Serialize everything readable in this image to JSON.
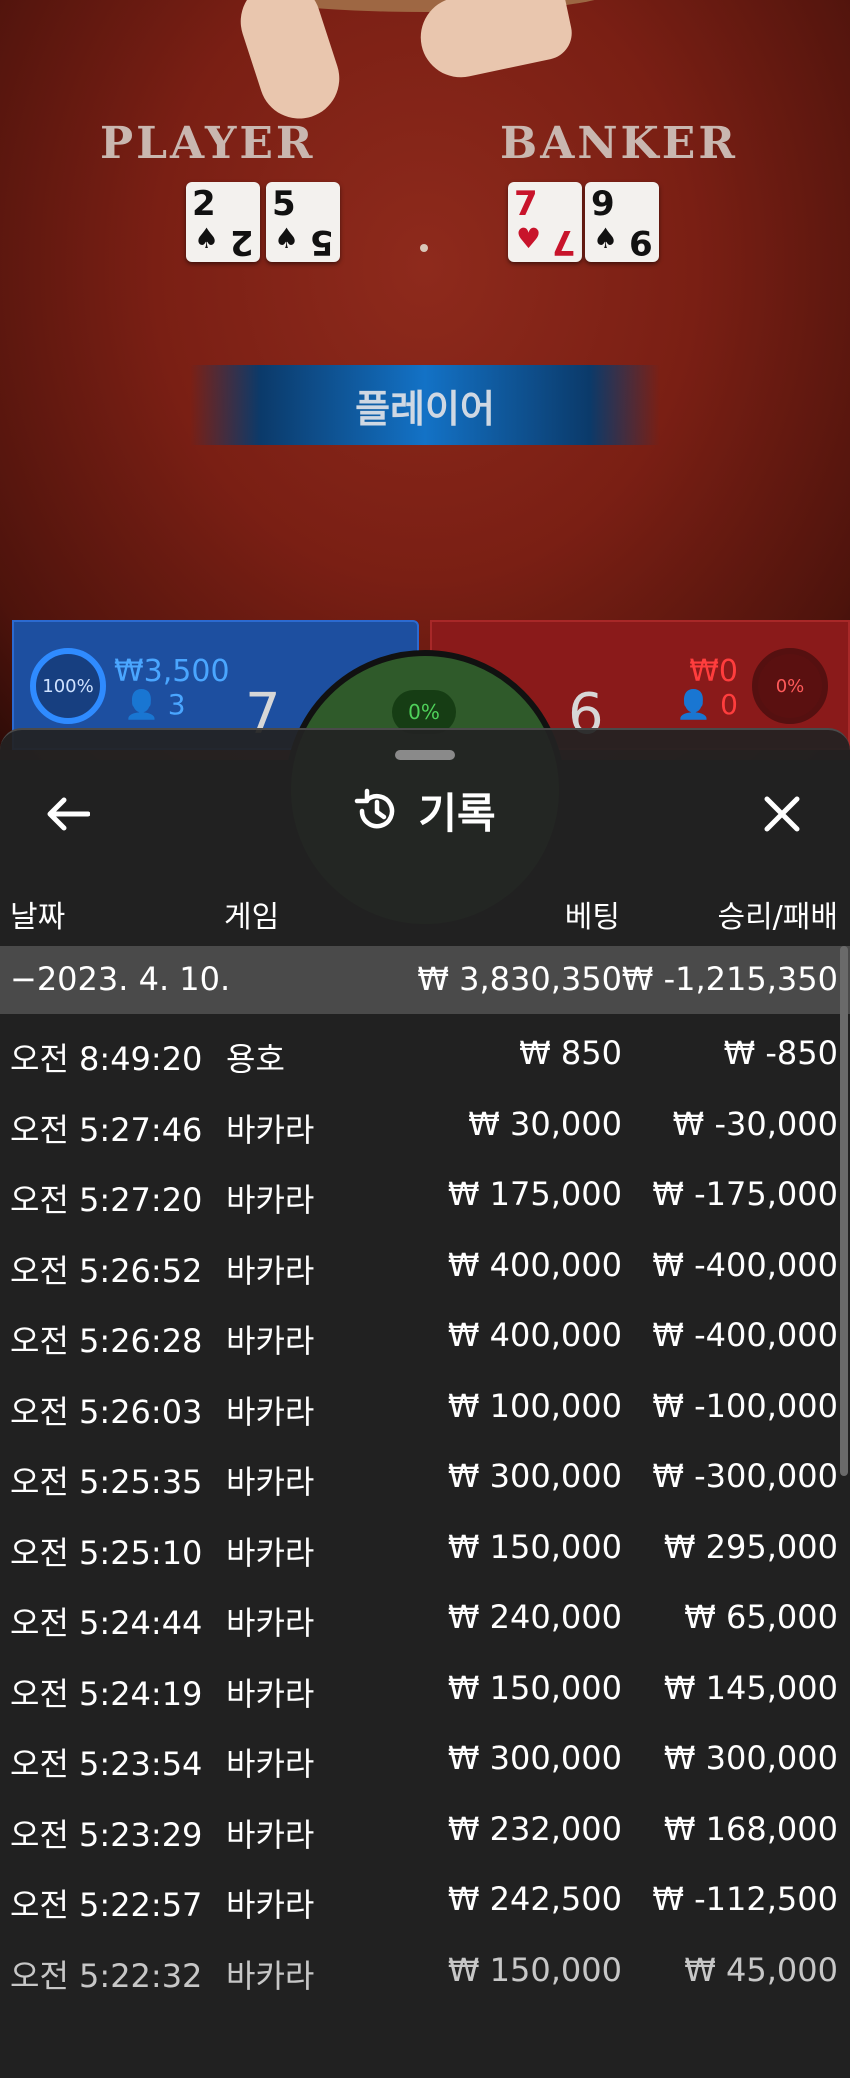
{
  "table": {
    "player_label": "PLAYER",
    "banker_label": "BANKER",
    "player_cards": [
      {
        "rank": "2",
        "suit": "♠",
        "color": "black"
      },
      {
        "rank": "5",
        "suit": "♠",
        "color": "black"
      }
    ],
    "banker_cards": [
      {
        "rank": "7",
        "suit": "♥",
        "color": "red"
      },
      {
        "rank": "9",
        "suit": "♠",
        "color": "black"
      }
    ],
    "result_text": "플레이어",
    "player_bet": {
      "percent": "100%",
      "amount": "₩3,500",
      "count": "3",
      "score": "7"
    },
    "banker_bet": {
      "percent": "0%",
      "amount": "₩0",
      "count": "0",
      "score": "6"
    },
    "tie_percent": "0%"
  },
  "sheet": {
    "title": "기록",
    "columns": {
      "date": "날짜",
      "game": "게임",
      "bet": "베팅",
      "winloss": "승리/패배"
    },
    "summary": {
      "date": "−2023. 4. 10.",
      "bet": "₩ 3,830,350",
      "winloss": "₩ -1,215,350"
    },
    "rows": [
      {
        "time": "오전 8:49:20",
        "game": "용호",
        "bet": "₩ 850",
        "winloss": "₩ -850"
      },
      {
        "time": "오전 5:27:46",
        "game": "바카라",
        "bet": "₩ 30,000",
        "winloss": "₩ -30,000"
      },
      {
        "time": "오전 5:27:20",
        "game": "바카라",
        "bet": "₩ 175,000",
        "winloss": "₩ -175,000"
      },
      {
        "time": "오전 5:26:52",
        "game": "바카라",
        "bet": "₩ 400,000",
        "winloss": "₩ -400,000"
      },
      {
        "time": "오전 5:26:28",
        "game": "바카라",
        "bet": "₩ 400,000",
        "winloss": "₩ -400,000"
      },
      {
        "time": "오전 5:26:03",
        "game": "바카라",
        "bet": "₩ 100,000",
        "winloss": "₩ -100,000"
      },
      {
        "time": "오전 5:25:35",
        "game": "바카라",
        "bet": "₩ 300,000",
        "winloss": "₩ -300,000"
      },
      {
        "time": "오전 5:25:10",
        "game": "바카라",
        "bet": "₩ 150,000",
        "winloss": "₩ 295,000"
      },
      {
        "time": "오전 5:24:44",
        "game": "바카라",
        "bet": "₩ 240,000",
        "winloss": "₩ 65,000"
      },
      {
        "time": "오전 5:24:19",
        "game": "바카라",
        "bet": "₩ 150,000",
        "winloss": "₩ 145,000"
      },
      {
        "time": "오전 5:23:54",
        "game": "바카라",
        "bet": "₩ 300,000",
        "winloss": "₩ 300,000"
      },
      {
        "time": "오전 5:23:29",
        "game": "바카라",
        "bet": "₩ 232,000",
        "winloss": "₩ 168,000"
      },
      {
        "time": "오전 5:22:57",
        "game": "바카라",
        "bet": "₩ 242,500",
        "winloss": "₩ -112,500"
      },
      {
        "time": "오전 5:22:32",
        "game": "바카라",
        "bet": "₩ 150,000",
        "winloss": "₩ 45,000"
      }
    ]
  }
}
